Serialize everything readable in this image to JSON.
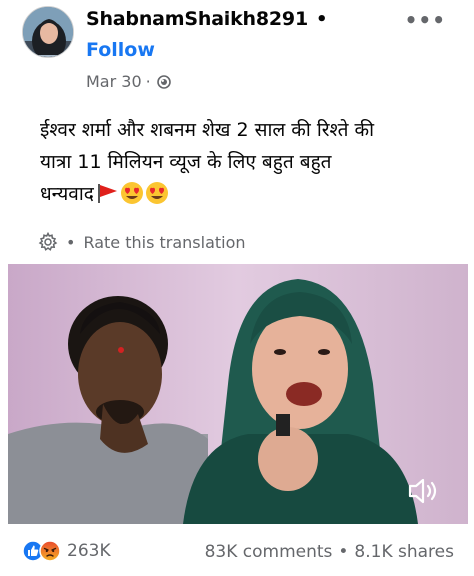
{
  "post": {
    "author": "ShabnamShaikh8291",
    "author_separator": "•",
    "follow_label": "Follow",
    "more_label": "•••",
    "date": "Mar 30",
    "date_separator": "·",
    "privacy_icon": "globe-icon",
    "text_line1": "ईश्वर शर्मा और शबनम शेख 2 साल की रिश्ते की",
    "text_line2": "यात्रा 11 मिलियन व्यूज के लिए बहुत बहुत",
    "text_line3": "धन्यवाद",
    "text_emojis": [
      "red-flag-icon",
      "heart-eyes-emoji",
      "heart-eyes-emoji"
    ]
  },
  "translation": {
    "icon": "gear-icon",
    "separator": "•",
    "label": "Rate this translation"
  },
  "video": {
    "sound_icon": "speaker-icon"
  },
  "footer": {
    "reaction_icons": [
      "like-icon",
      "angry-icon"
    ],
    "reaction_count": "263K",
    "comments": "83K comments",
    "separator": "•",
    "shares": "8.1K shares"
  },
  "colors": {
    "accent": "#1877f2",
    "secondary_text": "#65676b",
    "primary_text": "#050505"
  }
}
